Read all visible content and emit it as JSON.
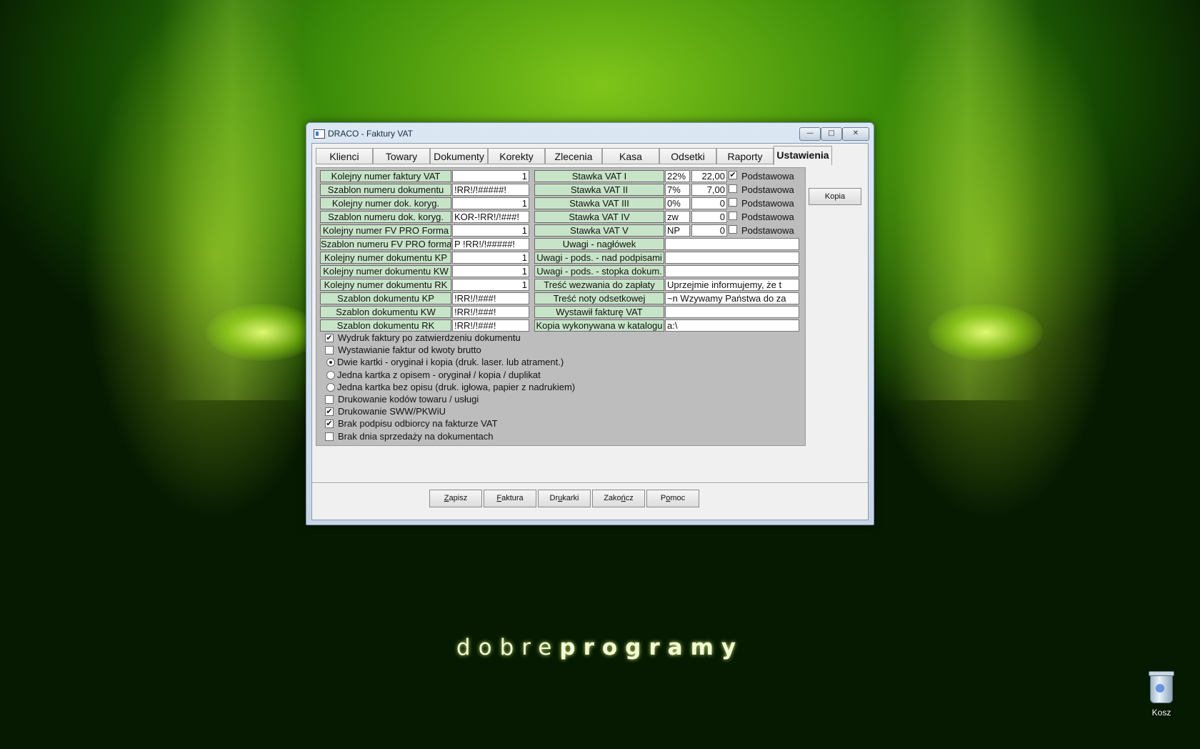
{
  "window": {
    "title": "DRACO - Faktury VAT",
    "buttons": {
      "minimize_icon": "minimize-icon",
      "maximize_icon": "maximize-icon",
      "close_icon": "close-icon"
    }
  },
  "tabs": [
    "Klienci",
    "Towary",
    "Dokumenty",
    "Korekty",
    "Zlecenia",
    "Kasa",
    "Odsetki",
    "Raporty",
    "Ustawienia"
  ],
  "active_tab": "Ustawienia",
  "left_fields": [
    {
      "label": "Kolejny numer faktury VAT",
      "value": "1",
      "numeric": true
    },
    {
      "label": "Szablon numeru dokumentu",
      "value": "!RR!/!#####!",
      "numeric": false
    },
    {
      "label": "Kolejny numer dok. koryg.",
      "value": "1",
      "numeric": true
    },
    {
      "label": "Szablon numeru dok. koryg.",
      "value": "KOR-!RR!/!###!",
      "numeric": false
    },
    {
      "label": "Kolejny numer FV PRO Forma",
      "value": "1",
      "numeric": true
    },
    {
      "label": "Szablon numeru FV PRO forma",
      "value": "P !RR!/!#####!",
      "numeric": false
    },
    {
      "label": "Kolejny numer dokumentu KP",
      "value": "1",
      "numeric": true
    },
    {
      "label": "Kolejny numer dokumentu KW",
      "value": "1",
      "numeric": true
    },
    {
      "label": "Kolejny numer dokumentu RK",
      "value": "1",
      "numeric": true
    },
    {
      "label": "Szablon dokumentu KP",
      "value": "!RR!/!###!",
      "numeric": false
    },
    {
      "label": "Szablon dokumentu KW",
      "value": "!RR!/!###!",
      "numeric": false
    },
    {
      "label": "Szablon dokumentu RK",
      "value": "!RR!/!###!",
      "numeric": false
    }
  ],
  "vat_rates": [
    {
      "label": "Stawka VAT I",
      "code": "22%",
      "rate": "22,00",
      "default_checked": true,
      "default_label": "Podstawowa"
    },
    {
      "label": "Stawka VAT II",
      "code": "7%",
      "rate": "7,00",
      "default_checked": false,
      "default_label": "Podstawowa"
    },
    {
      "label": "Stawka VAT III",
      "code": "0%",
      "rate": "0",
      "default_checked": false,
      "default_label": "Podstawowa"
    },
    {
      "label": "Stawka VAT IV",
      "code": "zw",
      "rate": "0",
      "default_checked": false,
      "default_label": "Podstawowa"
    },
    {
      "label": "Stawka VAT V",
      "code": "NP",
      "rate": "0",
      "default_checked": false,
      "default_label": "Podstawowa"
    }
  ],
  "right_fields": [
    {
      "label": "Uwagi - nagłówek",
      "value": ""
    },
    {
      "label": "Uwagi - pods. - nad podpisami",
      "value": ""
    },
    {
      "label": "Uwagi - pods. - stopka dokum.",
      "value": ""
    },
    {
      "label": "Treść wezwania do zapłaty",
      "value": "     Uprzejmie informujemy, że t"
    },
    {
      "label": "Treść noty odsetkowej",
      "value": "~n     Wzywamy Państwa do za"
    },
    {
      "label": "Wystawił fakturę VAT",
      "value": ""
    },
    {
      "label": "Kopia wykonywana w katalogu",
      "value": "a:\\"
    }
  ],
  "options": [
    {
      "type": "checkbox",
      "checked": true,
      "label": "Wydruk faktury po zatwierdzeniu dokumentu"
    },
    {
      "type": "checkbox",
      "checked": false,
      "label": "Wystawianie faktur od kwoty brutto"
    },
    {
      "type": "radio",
      "checked": true,
      "label": "Dwie kartki - oryginał i kopia (druk. laser. lub atrament.)"
    },
    {
      "type": "radio",
      "checked": false,
      "label": "Jedna kartka z opisem - oryginał / kopia / duplikat"
    },
    {
      "type": "radio",
      "checked": false,
      "label": "Jedna kartka bez opisu (druk. igłowa, papier z nadrukiem)"
    },
    {
      "type": "checkbox",
      "checked": false,
      "label": "Drukowanie kodów towaru / usługi"
    },
    {
      "type": "checkbox",
      "checked": true,
      "label": "Drukowanie SWW/PKWiU"
    },
    {
      "type": "checkbox",
      "checked": true,
      "label": "Brak podpisu odbiorcy na fakturze VAT"
    },
    {
      "type": "checkbox",
      "checked": false,
      "label": "Brak dnia sprzedaży na dokumentach"
    }
  ],
  "side_button": "Kopia",
  "bottom_buttons": [
    "Zapisz",
    "Faktura",
    "Drukarki",
    "Zakończ",
    "Pomoc"
  ],
  "desktop": {
    "brand_light": "dobre",
    "brand_bold": "programy",
    "recycle_bin_label": "Kosz"
  }
}
